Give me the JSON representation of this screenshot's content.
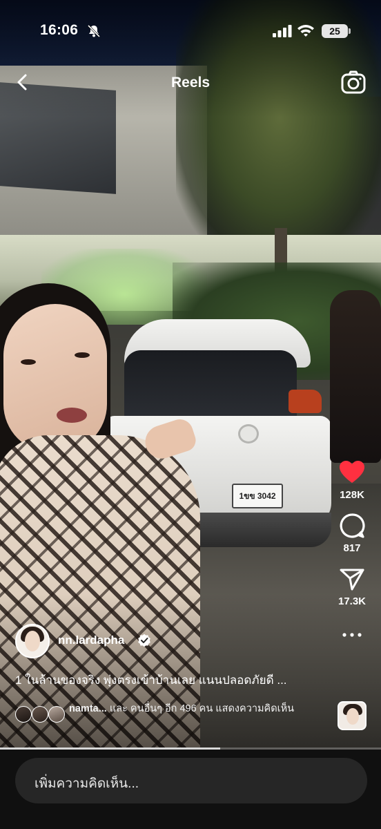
{
  "status_bar": {
    "time": "16:06",
    "battery": "25"
  },
  "header": {
    "title": "Reels"
  },
  "video": {
    "plate_text": "1ขข 3042"
  },
  "actions": {
    "like_count": "128K",
    "comment_count": "817",
    "share_count": "17.3K",
    "like_color": "#ff3040"
  },
  "post": {
    "username": "nn.lardapha",
    "caption": "1 ในล้านของจริง พุ่งตรงเข้าบ้านเลย แนนปลอดภัยดี ...",
    "comments_user": "namta...",
    "comments_summary": " และ คนอื่นๆ อีก 496 คน แสดงความคิดเห็น"
  },
  "playback": {
    "progress": 0.577
  },
  "comment_bar": {
    "placeholder": "เพิ่มความคิดเห็น..."
  }
}
